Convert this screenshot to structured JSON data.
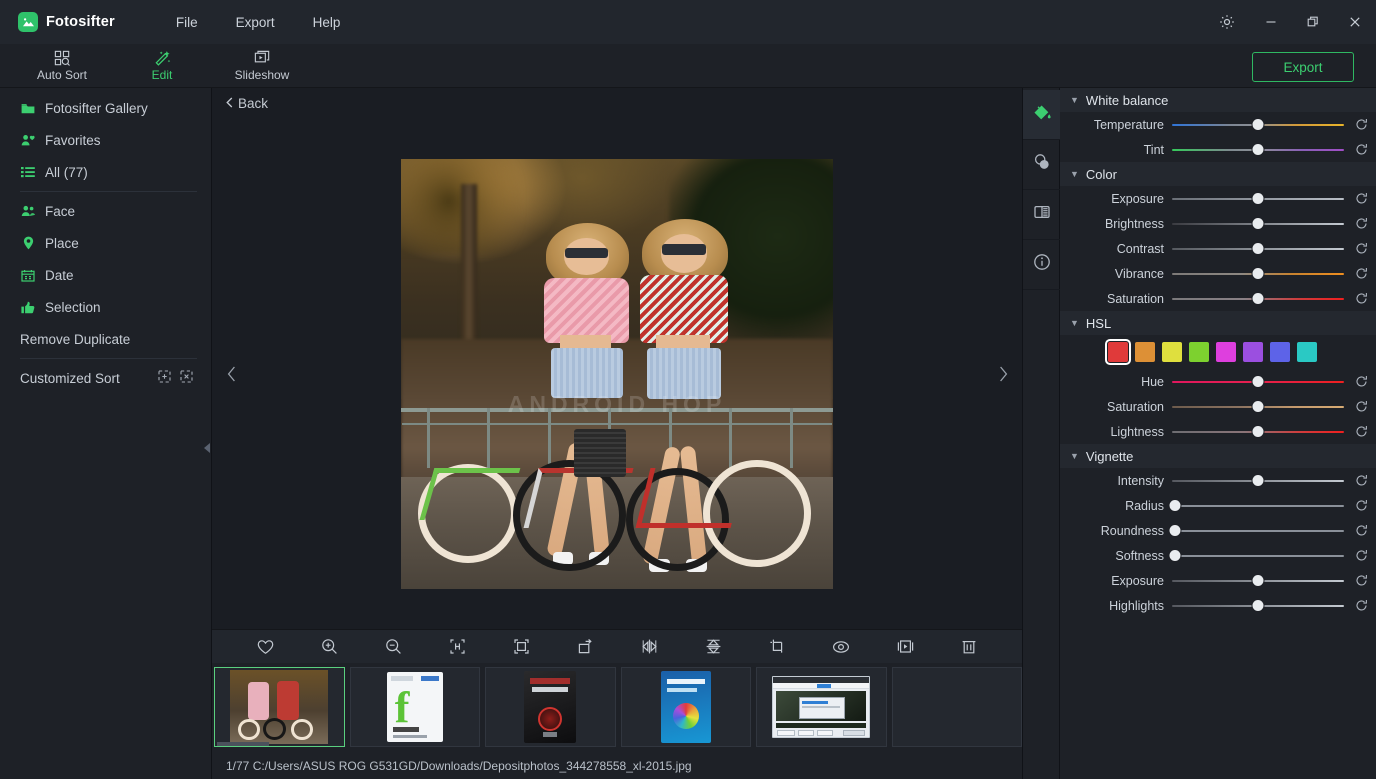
{
  "app": {
    "title": "Fotosifter",
    "logo_icon": "photo-logo-icon",
    "menus": [
      "File",
      "Export",
      "Help"
    ],
    "window_controls": {
      "settings": "gear-icon",
      "minimize": "minimize-icon",
      "restore": "restore-icon",
      "close": "close-icon"
    }
  },
  "modebar": {
    "modes": [
      {
        "label": "Auto Sort",
        "icon": "auto-sort-icon",
        "active": false
      },
      {
        "label": "Edit",
        "icon": "magic-wand-icon",
        "active": true
      },
      {
        "label": "Slideshow",
        "icon": "slideshow-icon",
        "active": false
      }
    ],
    "export_label": "Export",
    "accent": "#3ccf70"
  },
  "sidebar": {
    "items": [
      {
        "label": "Fotosifter Gallery",
        "icon": "folder-icon"
      },
      {
        "label": "Favorites",
        "icon": "favorite-person-icon"
      },
      {
        "label": "All (77)",
        "icon": "list-icon"
      },
      {
        "label": "Face",
        "icon": "face-icon"
      },
      {
        "label": "Place",
        "icon": "place-pin-icon"
      },
      {
        "label": "Date",
        "icon": "calendar-icon"
      },
      {
        "label": "Selection",
        "icon": "thumbs-up-icon"
      }
    ],
    "remove_duplicate": "Remove Duplicate",
    "customized_sort": "Customized Sort",
    "customized_icons": [
      "add-sort-icon",
      "remove-sort-icon"
    ],
    "collapse_icon": "collapse-left-icon"
  },
  "center": {
    "back_label": "Back",
    "back_icon": "chevron-left-icon",
    "prev_icon": "chevron-left-icon",
    "next_icon": "chevron-right-icon",
    "watermark": "ANDROID HOP",
    "toolbar": [
      {
        "name": "favorite",
        "icon": "heart-icon"
      },
      {
        "name": "zoom-in",
        "icon": "zoom-in-icon"
      },
      {
        "name": "zoom-out",
        "icon": "zoom-out-icon"
      },
      {
        "name": "actual-size",
        "icon": "actual-size-icon"
      },
      {
        "name": "fit-to-screen",
        "icon": "fit-screen-icon"
      },
      {
        "name": "rotate",
        "icon": "rotate-right-icon"
      },
      {
        "name": "flip-horizontal",
        "icon": "flip-horizontal-icon"
      },
      {
        "name": "flip-vertical",
        "icon": "flip-vertical-icon"
      },
      {
        "name": "crop",
        "icon": "crop-icon"
      },
      {
        "name": "preview",
        "icon": "eye-icon"
      },
      {
        "name": "play",
        "icon": "play-frame-icon"
      },
      {
        "name": "delete",
        "icon": "trash-icon"
      }
    ]
  },
  "filmstrip": {
    "thumbnails": [
      {
        "name": "two-girls-bicycles",
        "selected": true
      },
      {
        "name": "f-logo-box",
        "selected": false
      },
      {
        "name": "driver-booster-pro-box",
        "selected": false
      },
      {
        "name": "color-wheel-box",
        "selected": false
      },
      {
        "name": "video-converter-screenshot",
        "selected": false
      },
      {
        "name": "partial-thumbnail",
        "selected": false
      }
    ]
  },
  "statusbar": {
    "text": "1/77  C:/Users/ASUS ROG G531GD/Downloads/Depositphotos_344278558_xl-2015.jpg"
  },
  "rail": {
    "buttons": [
      {
        "name": "adjust-color",
        "icon": "paint-bucket-icon",
        "active": true
      },
      {
        "name": "effects",
        "icon": "overlapping-circles-icon",
        "active": false
      },
      {
        "name": "compare",
        "icon": "split-compare-icon",
        "active": false
      },
      {
        "name": "info",
        "icon": "info-icon",
        "active": false
      }
    ]
  },
  "panel": {
    "sections": [
      {
        "title": "White balance",
        "collapsed": false,
        "sliders": [
          {
            "label": "Temperature",
            "value": 50,
            "track": "temperature",
            "reset_icon": "reset-icon"
          },
          {
            "label": "Tint",
            "value": 50,
            "track": "tint",
            "reset_icon": "reset-icon"
          }
        ]
      },
      {
        "title": "Color",
        "collapsed": false,
        "sliders": [
          {
            "label": "Exposure",
            "value": 50,
            "track": "neutral",
            "reset_icon": "reset-icon"
          },
          {
            "label": "Brightness",
            "value": 50,
            "track": "neutral",
            "reset_icon": "reset-icon"
          },
          {
            "label": "Contrast",
            "value": 50,
            "track": "neutral",
            "reset_icon": "reset-icon"
          },
          {
            "label": "Vibrance",
            "value": 50,
            "track": "vibrance",
            "reset_icon": "reset-icon"
          },
          {
            "label": "Saturation",
            "value": 50,
            "track": "saturation",
            "reset_icon": "reset-icon"
          }
        ]
      },
      {
        "title": "HSL",
        "collapsed": false,
        "swatches": [
          {
            "name": "red",
            "color": "#e03a3a",
            "selected": true
          },
          {
            "name": "orange",
            "color": "#dd9036",
            "selected": false
          },
          {
            "name": "yellow",
            "color": "#dfdf3e",
            "selected": false
          },
          {
            "name": "green",
            "color": "#7dd12f",
            "selected": false
          },
          {
            "name": "magenta",
            "color": "#de3fde",
            "selected": false
          },
          {
            "name": "purple",
            "color": "#9b4fe0",
            "selected": false
          },
          {
            "name": "blue",
            "color": "#5d63e8",
            "selected": false
          },
          {
            "name": "cyan",
            "color": "#2ac9c4",
            "selected": false
          }
        ],
        "sliders": [
          {
            "label": "Hue",
            "value": 50,
            "track": "hue",
            "reset_icon": "reset-icon"
          },
          {
            "label": "Saturation",
            "value": 50,
            "track": "hsl-saturation",
            "reset_icon": "reset-icon"
          },
          {
            "label": "Lightness",
            "value": 50,
            "track": "lightness",
            "reset_icon": "reset-icon"
          }
        ]
      },
      {
        "title": "Vignette",
        "collapsed": false,
        "sliders": [
          {
            "label": "Intensity",
            "value": 50,
            "track": "neutral",
            "reset_icon": "reset-icon"
          },
          {
            "label": "Radius",
            "value": 0,
            "track": "neutral",
            "reset_icon": "reset-icon"
          },
          {
            "label": "Roundness",
            "value": 0,
            "track": "neutral",
            "reset_icon": "reset-icon"
          },
          {
            "label": "Softness",
            "value": 0,
            "track": "neutral",
            "reset_icon": "reset-icon"
          },
          {
            "label": "Exposure",
            "value": 50,
            "track": "neutral",
            "reset_icon": "reset-icon"
          },
          {
            "label": "Highlights",
            "value": 50,
            "track": "neutral",
            "reset_icon": "reset-icon"
          }
        ]
      }
    ]
  }
}
